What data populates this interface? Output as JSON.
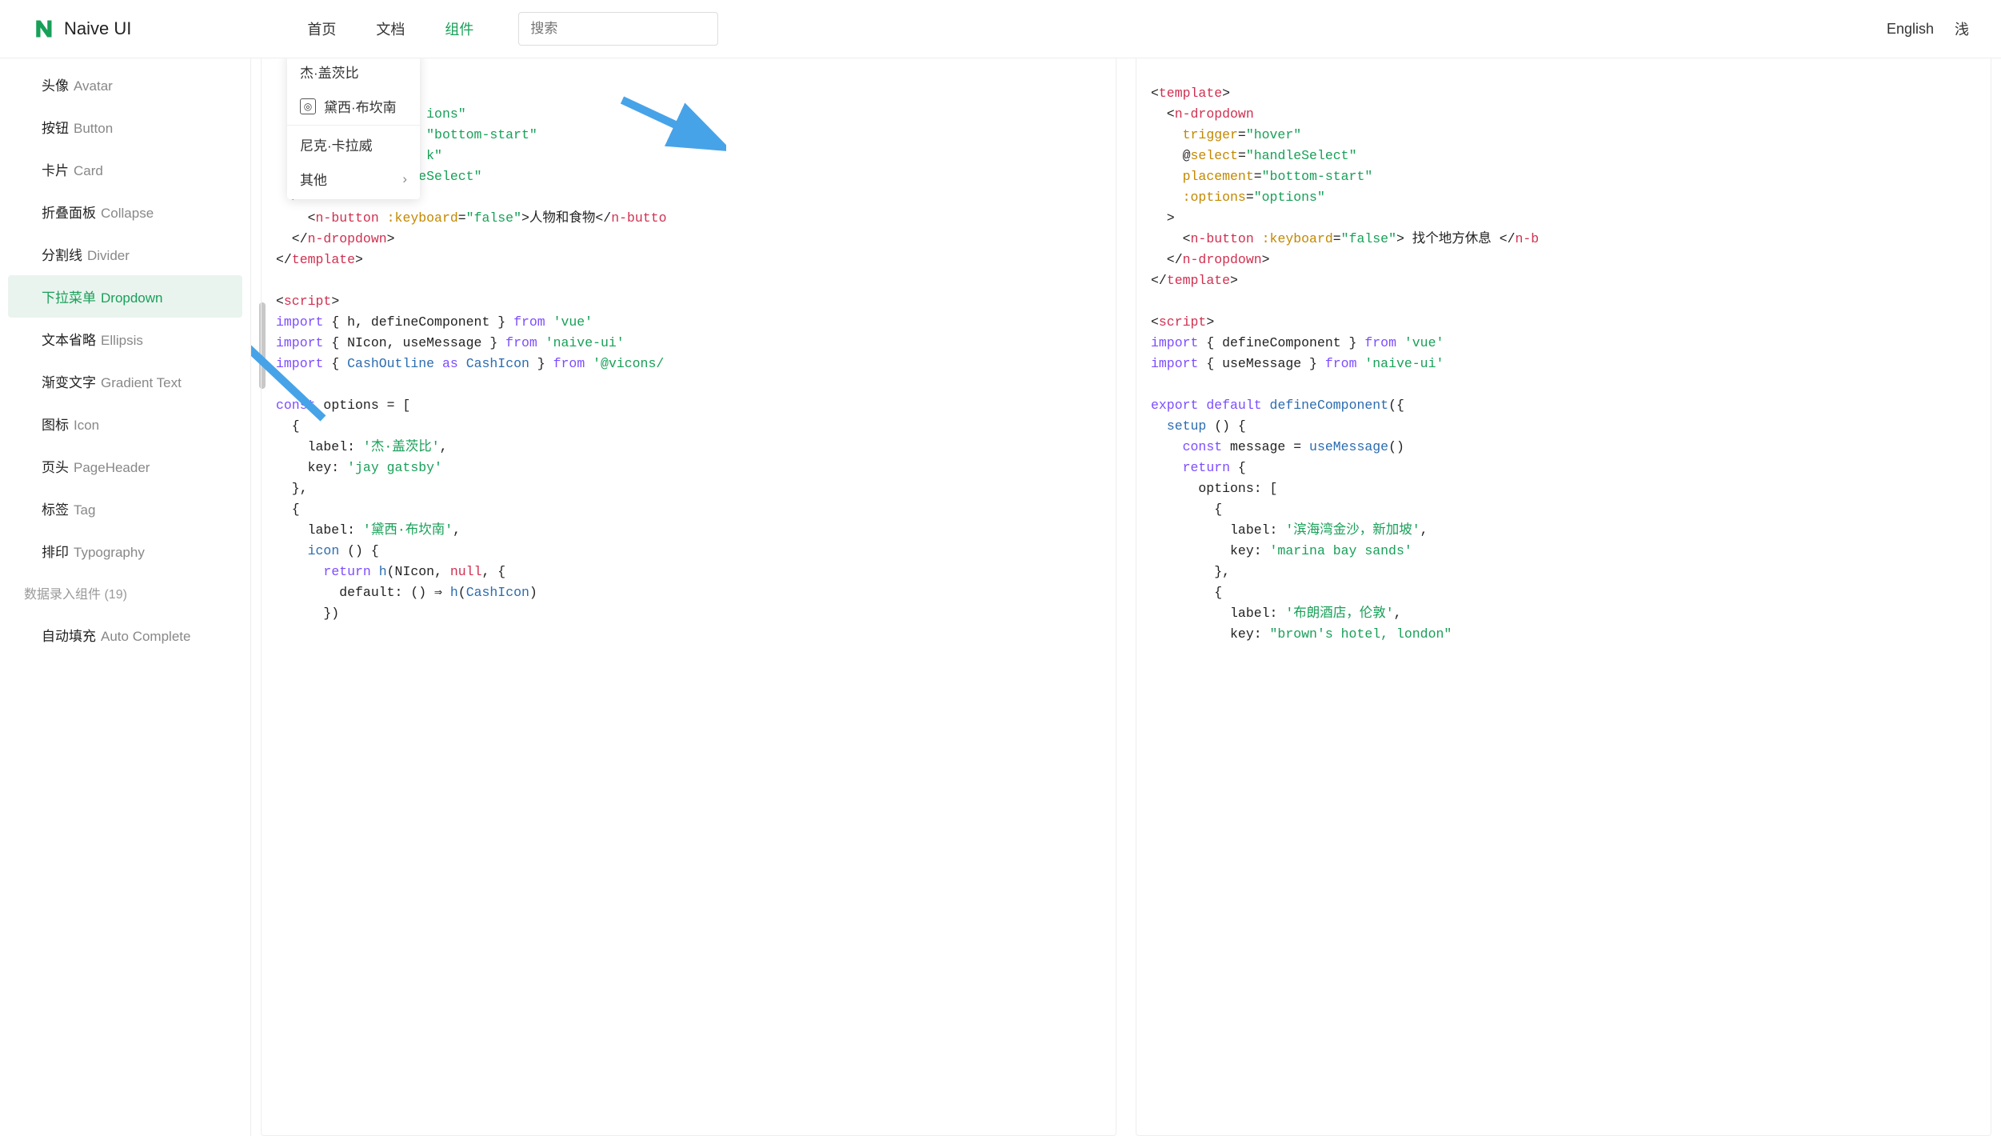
{
  "site": {
    "name": "Naive UI"
  },
  "nav": {
    "home": "首页",
    "docs": "文档",
    "components": "组件"
  },
  "search": {
    "placeholder": "搜索"
  },
  "lang": {
    "english": "English",
    "other": "浅"
  },
  "sidebar": {
    "items": [
      {
        "zh": "头像",
        "en": "Avatar"
      },
      {
        "zh": "按钮",
        "en": "Button"
      },
      {
        "zh": "卡片",
        "en": "Card"
      },
      {
        "zh": "折叠面板",
        "en": "Collapse"
      },
      {
        "zh": "分割线",
        "en": "Divider"
      },
      {
        "zh": "下拉菜单",
        "en": "Dropdown"
      },
      {
        "zh": "文本省略",
        "en": "Ellipsis"
      },
      {
        "zh": "渐变文字",
        "en": "Gradient Text"
      },
      {
        "zh": "图标",
        "en": "Icon"
      },
      {
        "zh": "页头",
        "en": "PageHeader"
      },
      {
        "zh": "标签",
        "en": "Tag"
      },
      {
        "zh": "排印",
        "en": "Typography"
      }
    ],
    "group": {
      "label": "数据录入组件",
      "count": "(19)"
    },
    "last": {
      "zh": "自动填充",
      "en": "Auto Complete"
    }
  },
  "dropdown": {
    "items": [
      {
        "label": "杰·盖茨比"
      },
      {
        "label": "黛西·布坎南",
        "icon": true
      },
      {
        "label": "尼克·卡拉威"
      },
      {
        "label": "其他",
        "submenu": true
      }
    ]
  },
  "codeL": {
    "l1a": "ions\"",
    "l1b": "\"bottom-start\"",
    "l1c": "k\"",
    "l1d": "handleSelect\"",
    "l2": "<n-button :keyboard=\"false\">人物和食物</n-butto",
    "l3": "import { h, defineComponent } from 'vue'",
    "l4": "import { NIcon, useMessage } from 'naive-ui'",
    "l5": "import { CashOutline as CashIcon } from '@vicons/",
    "l6": "const options = [",
    "l7": "label: '杰·盖茨比',",
    "l8": "key: 'jay gatsby'",
    "l9": "label: '黛西·布坎南',",
    "l10": "icon () {",
    "l11": "return h(NIcon, null, {",
    "l12": "default: () ⇒ h(CashIcon)",
    "l13": "})"
  },
  "codeR": {
    "l1": "<template>",
    "l2": "<n-dropdown",
    "l3": "trigger=\"hover\"",
    "l4": "@select=\"handleSelect\"",
    "l5": "placement=\"bottom-start\"",
    "l6": ":options=\"options\"",
    "l7": "<n-button :keyboard=\"false\"> 找个地方休息 </n-b",
    "l8": "</n-dropdown>",
    "l9": "</template>",
    "l10": "<script>",
    "l11": "import { defineComponent } from 'vue'",
    "l12": "import { useMessage } from 'naive-ui'",
    "l13": "export default defineComponent({",
    "l14": "setup () {",
    "l15": "const message = useMessage()",
    "l16": "return {",
    "l17": "options: [",
    "l18": "label: '滨海湾金沙，新加坡',",
    "l19": "key: 'marina bay sands'",
    "l20": "label: '布朗酒店，伦敦',",
    "l21": "key: \"brown's hotel, london\""
  }
}
